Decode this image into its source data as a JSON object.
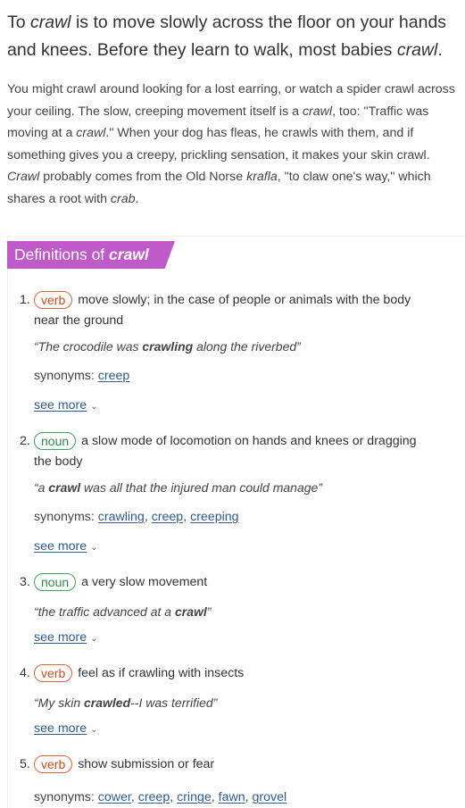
{
  "blurb": {
    "short": [
      "To ",
      "crawl",
      " is to move slowly across the floor on your hands and knees. Before they learn to walk, most babies ",
      "crawl",
      "."
    ],
    "long": [
      "You might crawl around looking for a lost earring, or watch a spider crawl across your ceiling. The slow, creeping movement itself is a ",
      "crawl",
      ", too: \"Traffic was moving at a ",
      "crawl",
      ".\" When your dog has fleas, he crawls with them, and if something gives you a creepy, prickling sensation, it makes your skin crawl. ",
      "Crawl",
      " probably comes from the Old Norse ",
      "krafla",
      ", \"to claw one's way,\" which shares a root with ",
      "crab",
      "."
    ]
  },
  "definitions": {
    "header_prefix": "Definitions of ",
    "header_word": "crawl",
    "synonyms_label": "synonyms:",
    "see_more_label": "see more",
    "senses": [
      {
        "num": "1.",
        "pos": "verb",
        "def_first": "move slowly; in the case of people or animals with the body",
        "def_rest": "near the ground",
        "example": [
          "“The crocodile was ",
          "crawling",
          " along the riverbed”"
        ],
        "synonyms": [
          "creep"
        ]
      },
      {
        "num": "2.",
        "pos": "noun",
        "def_first": "a slow mode of locomotion on hands and knees or dragging",
        "def_rest": "the body",
        "example": [
          "“a ",
          "crawl",
          " was all that the injured man could manage”"
        ],
        "synonyms": [
          "crawling",
          "creep",
          "creeping"
        ]
      },
      {
        "num": "3.",
        "pos": "noun",
        "def_first": "a very slow movement",
        "example": [
          "“the traffic advanced at a ",
          "crawl",
          "”"
        ]
      },
      {
        "num": "4.",
        "pos": "verb",
        "def_first": "feel as if crawling with insects",
        "example": [
          "“My skin ",
          "crawled",
          "--I was terrified”"
        ]
      },
      {
        "num": "5.",
        "pos": "verb",
        "def_first": "show submission or fear",
        "synonyms": [
          "cower",
          "creep",
          "cringe",
          "fawn",
          "grovel"
        ]
      }
    ]
  },
  "colors": {
    "header_bg": "#c05acb",
    "verb": "#e0653b",
    "noun": "#3aa55b",
    "link": "#2f5a8f"
  }
}
